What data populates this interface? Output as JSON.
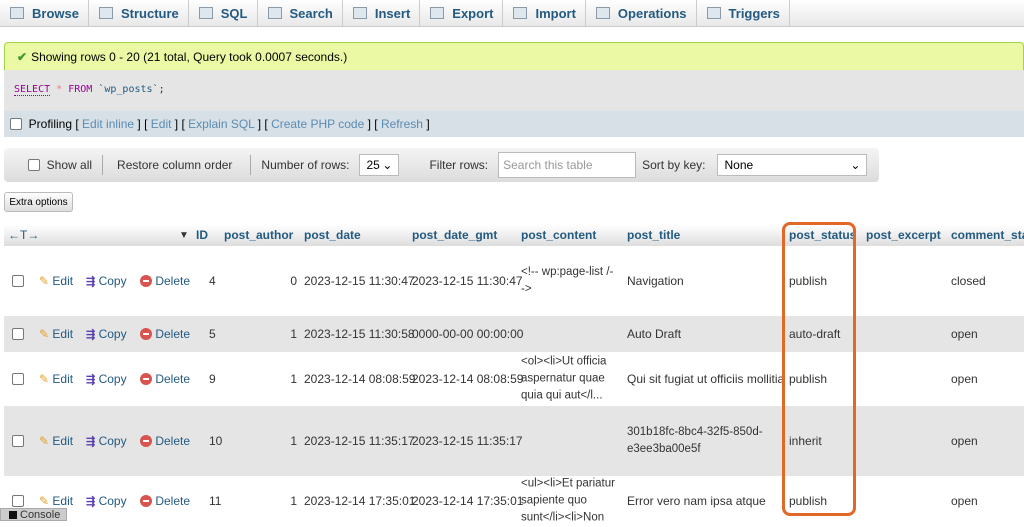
{
  "tabs": [
    {
      "label": "Browse",
      "icon": "browse-icon"
    },
    {
      "label": "Structure",
      "icon": "structure-icon"
    },
    {
      "label": "SQL",
      "icon": "sql-icon"
    },
    {
      "label": "Search",
      "icon": "search-icon"
    },
    {
      "label": "Insert",
      "icon": "insert-icon"
    },
    {
      "label": "Export",
      "icon": "export-icon"
    },
    {
      "label": "Import",
      "icon": "import-icon"
    },
    {
      "label": "Operations",
      "icon": "operations-icon"
    },
    {
      "label": "Triggers",
      "icon": "triggers-icon"
    }
  ],
  "message": "Showing rows 0 - 20 (21 total, Query took 0.0007 seconds.)",
  "sql": {
    "select": "SELECT",
    "star": "*",
    "from": "FROM",
    "table": "`wp_posts`",
    "end": ";"
  },
  "profiling": {
    "label": "Profiling",
    "links": [
      "Edit inline",
      "Edit",
      "Explain SQL",
      "Create PHP code",
      "Refresh"
    ]
  },
  "nav": {
    "show_all": "Show all",
    "restore": "Restore column order",
    "num_rows_label": "Number of rows:",
    "num_rows": "25",
    "filter_label": "Filter rows:",
    "filter_placeholder": "Search this table",
    "sort_label": "Sort by key:",
    "sort_value": "None"
  },
  "extra_options": "Extra options",
  "columns": [
    "ID",
    "post_author",
    "post_date",
    "post_date_gmt",
    "post_content",
    "post_title",
    "post_status",
    "post_excerpt",
    "comment_sta"
  ],
  "actions": {
    "edit": "Edit",
    "copy": "Copy",
    "delete": "Delete"
  },
  "rows": [
    {
      "ID": "4",
      "post_author": "0",
      "post_date": "2023-12-15 11:30:47",
      "post_date_gmt": "2023-12-15 11:30:47",
      "post_content": "<!-- wp:page-list /-->",
      "post_title": "Navigation",
      "post_status": "publish",
      "post_excerpt": "",
      "comment_status": "closed"
    },
    {
      "ID": "5",
      "post_author": "1",
      "post_date": "2023-12-15 11:30:58",
      "post_date_gmt": "0000-00-00 00:00:00",
      "post_content": "",
      "post_title": "Auto Draft",
      "post_status": "auto-draft",
      "post_excerpt": "",
      "comment_status": "open"
    },
    {
      "ID": "9",
      "post_author": "1",
      "post_date": "2023-12-14 08:08:59",
      "post_date_gmt": "2023-12-14 08:08:59",
      "post_content": "<ol><li>Ut officia aspernatur quae quia qui aut</l...",
      "post_title": "Qui sit fugiat ut officiis mollitia",
      "post_status": "publish",
      "post_excerpt": "",
      "comment_status": "open"
    },
    {
      "ID": "10",
      "post_author": "1",
      "post_date": "2023-12-15 11:35:17",
      "post_date_gmt": "2023-12-15 11:35:17",
      "post_content": "",
      "post_title": "301b18fc-8bc4-32f5-850d-e3ee3ba00e5f",
      "post_status": "inherit",
      "post_excerpt": "",
      "comment_status": "open"
    },
    {
      "ID": "11",
      "post_author": "1",
      "post_date": "2023-12-14 17:35:01",
      "post_date_gmt": "2023-12-14 17:35:01",
      "post_content": "<ul><li>Et pariatur sapiente quo sunt</li><li>Non",
      "post_title": "Error vero nam ipsa atque",
      "post_status": "publish",
      "post_excerpt": "",
      "comment_status": "open"
    }
  ],
  "console": "Console",
  "colors": {
    "highlight": "#e2682a",
    "message_bg": "#ebf8a4",
    "link": "#235a81"
  }
}
